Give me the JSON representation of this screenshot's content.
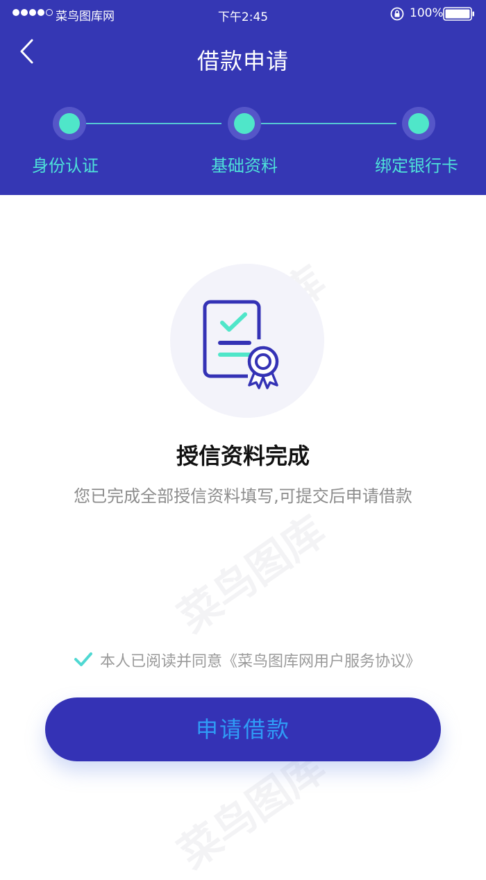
{
  "status_bar": {
    "carrier": "菜鸟图库网",
    "time": "下午2:45",
    "battery": "100%",
    "icons": [
      "signal-icon",
      "rotation-lock-icon",
      "battery-icon"
    ]
  },
  "nav": {
    "back_icon": "chevron-left-icon",
    "title": "借款申请"
  },
  "steps": [
    {
      "label": "身份认证",
      "state": "done"
    },
    {
      "label": "基础资料",
      "state": "done"
    },
    {
      "label": "绑定银行卡",
      "state": "done"
    }
  ],
  "result": {
    "icon": "certificate-check-icon",
    "title": "授信资料完成",
    "description": "您已完成全部授信资料填写,可提交后申请借款"
  },
  "agreement": {
    "checked": true,
    "text": "本人已阅读并同意《菜鸟图库网用户服务协议》"
  },
  "submit_button": {
    "label": "申请借款"
  },
  "watermark": "菜鸟图库",
  "colors": {
    "header_bg": "#3537b4",
    "accent_teal": "#4fe6c9",
    "button_bg": "#3432b5",
    "button_text": "#2f9cf6"
  }
}
